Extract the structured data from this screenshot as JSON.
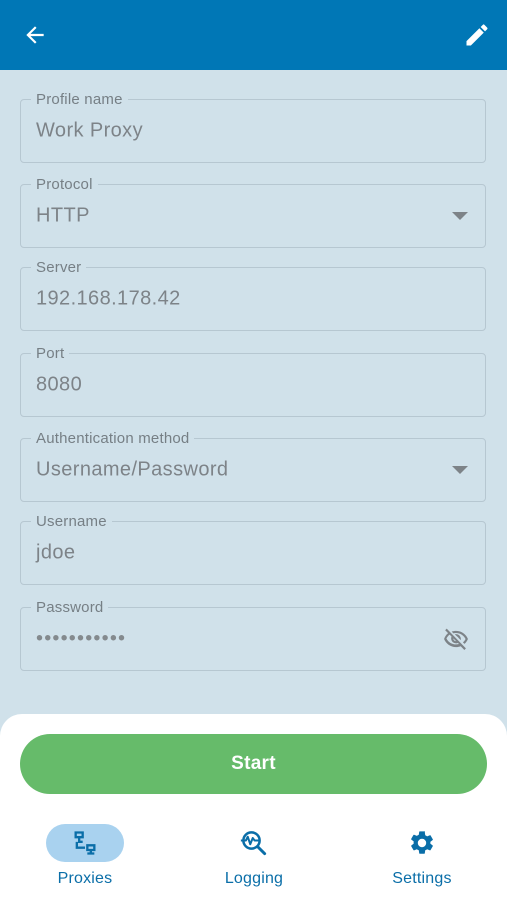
{
  "appbar": {
    "back_icon": "arrow-left-icon",
    "edit_icon": "pencil-icon",
    "background": "#0077b6"
  },
  "form": {
    "fields": [
      {
        "label": "Profile name",
        "value": "Work Proxy"
      },
      {
        "label": "Protocol",
        "value": "HTTP",
        "dropdown": true
      },
      {
        "label": "Server",
        "value": "192.168.178.42"
      },
      {
        "label": "Port",
        "value": "8080"
      },
      {
        "label": "Authentication method",
        "value": "Username/Password",
        "dropdown": true
      },
      {
        "label": "Username",
        "value": "jdoe"
      },
      {
        "label": "Password",
        "value": "•••••••••••",
        "visibility_icon": "eye-off-icon"
      }
    ]
  },
  "actions": {
    "start_label": "Start",
    "start_color": "#66bb6a"
  },
  "nav": {
    "items": [
      {
        "label": "Proxies",
        "icon": "network-icon",
        "active": true
      },
      {
        "label": "Logging",
        "icon": "search-activity-icon",
        "active": false
      },
      {
        "label": "Settings",
        "icon": "gear-icon",
        "active": false
      }
    ],
    "accent": "#0a6ea8",
    "active_pill": "#a9d2ef"
  }
}
